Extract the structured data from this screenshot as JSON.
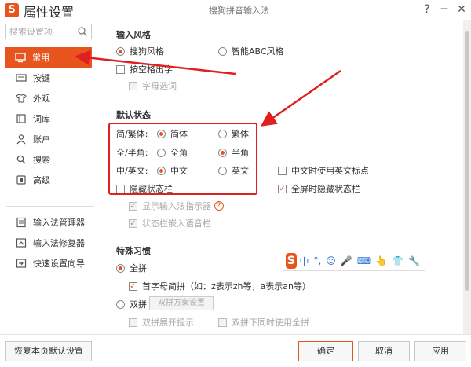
{
  "window": {
    "title": "属性设置",
    "subtitle": "搜狗拼音输入法",
    "logo": "S",
    "help_glyph": "?",
    "minimize_glyph": "─",
    "close_glyph": "✕"
  },
  "sidebar": {
    "search_placeholder": "搜索设置项",
    "items": [
      {
        "label": "常用",
        "icon": "monitor-icon"
      },
      {
        "label": "按键",
        "icon": "keyboard-icon"
      },
      {
        "label": "外观",
        "icon": "shirt-icon"
      },
      {
        "label": "词库",
        "icon": "book-icon"
      },
      {
        "label": "账户",
        "icon": "user-icon"
      },
      {
        "label": "搜索",
        "icon": "search-icon"
      },
      {
        "label": "高级",
        "icon": "advanced-icon"
      }
    ],
    "tools": [
      {
        "label": "输入法管理器",
        "icon": "manager-icon"
      },
      {
        "label": "输入法修复器",
        "icon": "repair-icon"
      },
      {
        "label": "快速设置向导",
        "icon": "wizard-icon"
      }
    ]
  },
  "input_style": {
    "title": "输入风格",
    "sogou": "搜狗风格",
    "abc": "智能ABC风格",
    "space_output": "按空格出字",
    "letter_select": "字母选词"
  },
  "default_state": {
    "title": "默认状态",
    "simp_trad_label": "简/繁体:",
    "simp": "简体",
    "trad": "繁体",
    "width_label": "全/半角:",
    "full": "全角",
    "half": "半角",
    "lang_label": "中/英文:",
    "chinese": "中文",
    "english": "英文",
    "cn_use_en_punct": "中文时使用英文标点",
    "hide_status_bar": "隐藏状态栏",
    "fullscreen_hide": "全屏时隐藏状态栏",
    "show_indicator": "显示输入法指示器",
    "embed_voice": "状态栏嵌入语音栏",
    "help_glyph": "?"
  },
  "special_habits": {
    "title": "特殊习惯",
    "quanpin": "全拼",
    "initial_abbrev": "首字母简拼（如：z表示zh等，a表示an等）",
    "shuangpin": "双拼",
    "shuangpin_settings": "双拼方案设置",
    "shuangpin_expand": "双拼展开提示",
    "shuangpin_full": "双拼下同时使用全拼"
  },
  "status_toolbar": {
    "logo": "S",
    "glyphs": [
      "中",
      "°,",
      "☺",
      "🎤",
      "⌨",
      "👆",
      "👕",
      "🔧"
    ]
  },
  "footer": {
    "restore": "恢复本页默认设置",
    "ok": "确定",
    "cancel": "取消",
    "apply": "应用"
  },
  "colors": {
    "accent": "#e8541e",
    "highlight_box": "#e02020"
  }
}
